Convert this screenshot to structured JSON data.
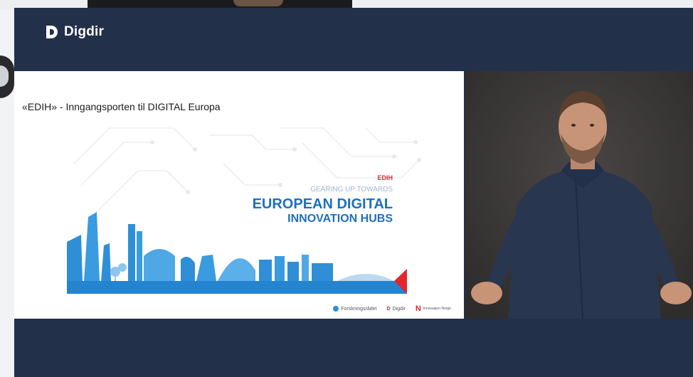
{
  "app": {
    "brand_name": "Digdir",
    "brand_color": "#22304a"
  },
  "slide": {
    "title": "«EDIH» - Inngangsporten til DIGITAL Europa",
    "badge": "EDIH",
    "tagline": "GEARING UP TOWARDS",
    "headline_line1": "EUROPEAN DIGITAL",
    "headline_line2": "INNOVATION HUBS",
    "footer_logos": [
      "Forskningsrådet",
      "Digdir",
      "Innovasjon Norge"
    ]
  },
  "speaker_video": {
    "icon": "presenter-video-feed"
  },
  "colors": {
    "skyline_blue": "#2f8fd6",
    "headline_blue": "#1e6fc0",
    "accent_red": "#e3262e",
    "background_gray": "#3b3838"
  }
}
